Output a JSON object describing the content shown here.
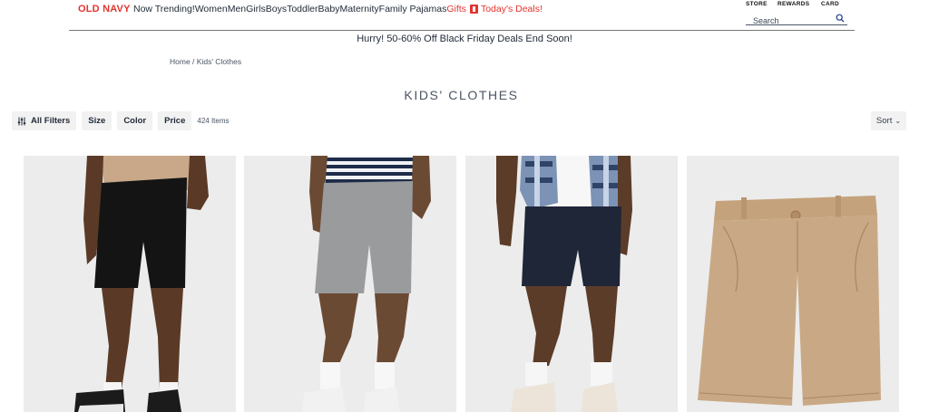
{
  "brand": {
    "logo_text": "OLD NAVY",
    "color": "#e3342f"
  },
  "nav": {
    "items": [
      "Now Trending!",
      "Women",
      "Men",
      "Girls",
      "Boys",
      "Toddler",
      "Baby",
      "Maternity",
      "Family Pajamas"
    ],
    "gifts_label": "Gifts",
    "deals_label": "Today's Deals!",
    "accent_color": "#e3342f"
  },
  "utility": {
    "store": "STORE",
    "rewards": "REWARDS",
    "card": "CARD"
  },
  "search": {
    "placeholder": "Search",
    "icon": "search-icon"
  },
  "promo": {
    "text": "Hurry! 50-60% Off Black Friday Deals End Soon!"
  },
  "breadcrumb": {
    "home": "Home",
    "separator": " / ",
    "current": "Kids' Clothes"
  },
  "page": {
    "title": "KIDS' CLOTHES"
  },
  "filters": {
    "all_label": "All Filters",
    "size_label": "Size",
    "color_label": "Color",
    "price_label": "Price",
    "item_count": "424 Items",
    "sort_label": "Sort"
  },
  "products": [
    {
      "description": "black shorts",
      "shorts_color": "#141414"
    },
    {
      "description": "gray shorts",
      "shorts_color": "#9a9b9d"
    },
    {
      "description": "navy shorts",
      "shorts_color": "#1f2638"
    },
    {
      "description": "khaki shorts",
      "shorts_color": "#c9a985"
    }
  ]
}
